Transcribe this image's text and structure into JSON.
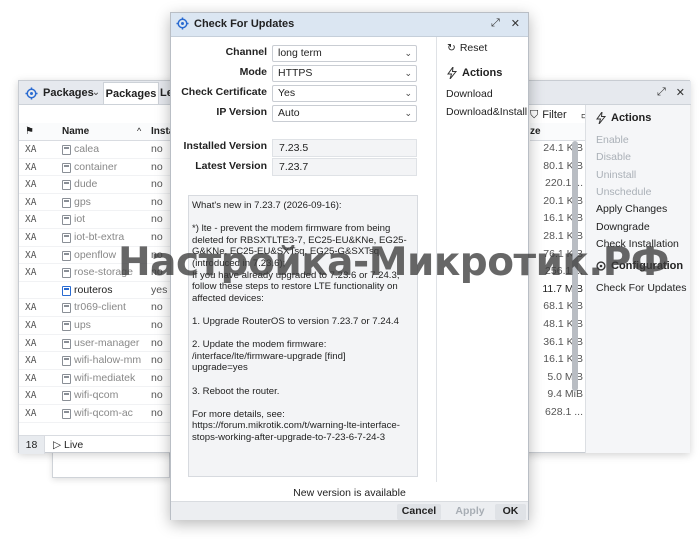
{
  "packages_window": {
    "title": "Packages",
    "dropdown": "⌄",
    "tab_packages": "Packages",
    "tab_other": "Le",
    "columns": {
      "name": "Name",
      "sort": "^",
      "installed": "Insta",
      "size": "ze"
    },
    "filter": "Filter",
    "rows": [
      {
        "flag": "XA",
        "name": "calea",
        "installed": "no",
        "size": "24.1 KiB",
        "active": false
      },
      {
        "flag": "XA",
        "name": "container",
        "installed": "no",
        "size": "80.1 KiB",
        "active": false
      },
      {
        "flag": "XA",
        "name": "dude",
        "installed": "no",
        "size": "220.1 ...",
        "active": false
      },
      {
        "flag": "XA",
        "name": "gps",
        "installed": "no",
        "size": "20.1 KiB",
        "active": false
      },
      {
        "flag": "XA",
        "name": "iot",
        "installed": "no",
        "size": "16.1 KiB",
        "active": false
      },
      {
        "flag": "XA",
        "name": "iot-bt-extra",
        "installed": "no",
        "size": "28.1 KiB",
        "active": false
      },
      {
        "flag": "XA",
        "name": "openflow",
        "installed": "no",
        "size": "76.1 KiB",
        "active": false
      },
      {
        "flag": "XA",
        "name": "rose-storage",
        "installed": "no",
        "size": "256.1 ...",
        "active": false
      },
      {
        "flag": "",
        "name": "routeros",
        "installed": "yes",
        "size": "11.7 MiB",
        "active": true
      },
      {
        "flag": "XA",
        "name": "tr069-client",
        "installed": "no",
        "size": "68.1 KiB",
        "active": false
      },
      {
        "flag": "XA",
        "name": "ups",
        "installed": "no",
        "size": "48.1 KiB",
        "active": false
      },
      {
        "flag": "XA",
        "name": "user-manager",
        "installed": "no",
        "size": "36.1 KiB",
        "active": false
      },
      {
        "flag": "XA",
        "name": "wifi-halow-mm",
        "installed": "no",
        "size": "16.1 KiB",
        "active": false
      },
      {
        "flag": "XA",
        "name": "wifi-mediatek",
        "installed": "no",
        "size": "5.0 MiB",
        "active": false
      },
      {
        "flag": "XA",
        "name": "wifi-qcom",
        "installed": "no",
        "size": "9.4 MiB",
        "active": false
      },
      {
        "flag": "XA",
        "name": "wifi-qcom-ac",
        "installed": "no",
        "size": "628.1 ...",
        "active": false
      }
    ],
    "count": "18",
    "live": "Live",
    "actions_title": "Actions",
    "actions": [
      {
        "label": "Enable",
        "disabled": true
      },
      {
        "label": "Disable",
        "disabled": true
      },
      {
        "label": "Uninstall",
        "disabled": true
      },
      {
        "label": "Unschedule",
        "disabled": true
      },
      {
        "label": "Apply Changes",
        "disabled": false
      },
      {
        "label": "Downgrade",
        "disabled": false
      },
      {
        "label": "Check Installation",
        "disabled": false
      }
    ],
    "configuration_title": "Configuration",
    "configuration_items": [
      "Check For Updates"
    ]
  },
  "watermark": "Настройка-Микротик.РФ",
  "dialog": {
    "title": "Check For Updates",
    "fields": {
      "channel": {
        "label": "Channel",
        "value": "long term"
      },
      "mode": {
        "label": "Mode",
        "value": "HTTPS"
      },
      "check_certificate": {
        "label": "Check Certificate",
        "value": "Yes"
      },
      "ip_version": {
        "label": "IP Version",
        "value": "Auto"
      },
      "installed_version": {
        "label": "Installed Version",
        "value": "7.23.5"
      },
      "latest_version": {
        "label": "Latest Version",
        "value": "7.23.7"
      }
    },
    "release_notes": "What's new in 7.23.7 (2026-09-16):\n\n*) lte - prevent the modem firmware from being deleted for RBSXTLTE3-7, EC25-EU&KNe, EG25-G&KNe, EC25-EU&SXTsq, EG25-G&SXTsq (introduced in 7.23.6);\nIf you have already upgraded to 7.23.6 or 7.24.3, follow these steps to restore LTE functionality on affected devices:\n\n1. Upgrade RouterOS to version 7.23.7 or 7.24.4\n\n2. Update the modem firmware:\n/interface/lte/firmware-upgrade [find]\nupgrade=yes\n\n3. Reboot the router.\n\nFor more details, see:\nhttps://forum.mikrotik.com/t/warning-lte-interface-stops-working-after-upgrade-to-7-23-6-7-24-3",
    "reset_label": "Reset",
    "actions_title": "Actions",
    "actions": [
      "Download",
      "Download&Install"
    ],
    "status": "New version is available",
    "buttons": {
      "cancel": "Cancel",
      "apply": "Apply",
      "ok": "OK"
    }
  }
}
